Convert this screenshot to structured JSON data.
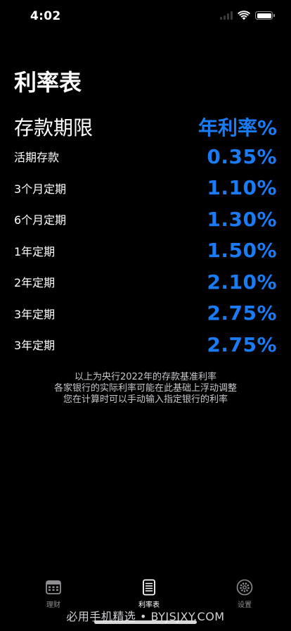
{
  "status_bar": {
    "time": "4:02"
  },
  "page": {
    "title": "利率表"
  },
  "table": {
    "header_term": "存款期限",
    "header_rate": "年利率%",
    "rows": [
      {
        "term": "活期存款",
        "rate": "0.35%"
      },
      {
        "term": "3个月定期",
        "rate": "1.10%"
      },
      {
        "term": "6个月定期",
        "rate": "1.30%"
      },
      {
        "term": "1年定期",
        "rate": "1.50%"
      },
      {
        "term": "2年定期",
        "rate": "2.10%"
      },
      {
        "term": "3年定期",
        "rate": "2.75%"
      },
      {
        "term": "3年定期",
        "rate": "2.75%"
      }
    ]
  },
  "note": {
    "line1": "以上为央行2022年的存款基准利率",
    "line2": "各家银行的实际利率可能在此基础上浮动调整",
    "line3": "您在计算时可以手动输入指定银行的利率"
  },
  "tabs": [
    {
      "label": "理财",
      "icon": "calculator-icon",
      "active": false
    },
    {
      "label": "利率表",
      "icon": "document-list-icon",
      "active": true
    },
    {
      "label": "设置",
      "icon": "gear-icon",
      "active": false
    }
  ],
  "watermark": "必用手机精选 • BYJSJXY.COM",
  "colors": {
    "accent": "#1a7cf5",
    "background": "#000000",
    "inactive_tab": "#8e8e93"
  }
}
